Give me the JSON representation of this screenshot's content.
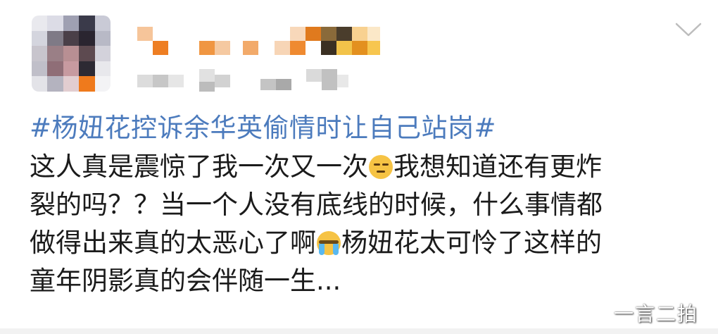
{
  "post": {
    "topic": "#杨妞花控诉余华英偷情时让自己站岗#",
    "lines": [
      {
        "before": "这人真是震惊了我一次又一次",
        "emoji": "smirk-face-icon",
        "after": "我想知道还有更炸"
      },
      {
        "text": "裂的吗？？当一个人没有底线的时候，什么事情都"
      },
      {
        "before": "做得出来真的太恶心了啊",
        "emoji": "crying-face-icon",
        "after": "杨妞花太可怜了这样的"
      },
      {
        "text": "童年阴影真的会伴随一生..."
      }
    ]
  },
  "header": {
    "avatar": "blurred-avatar",
    "username_blurred": true,
    "meta_blurred": true,
    "menu_icon": "chevron-down-icon"
  },
  "watermark": "一言二拍",
  "colors": {
    "topic": "#4c7bbd",
    "text": "#1b1b1b",
    "chevron": "#bdbdbd"
  }
}
